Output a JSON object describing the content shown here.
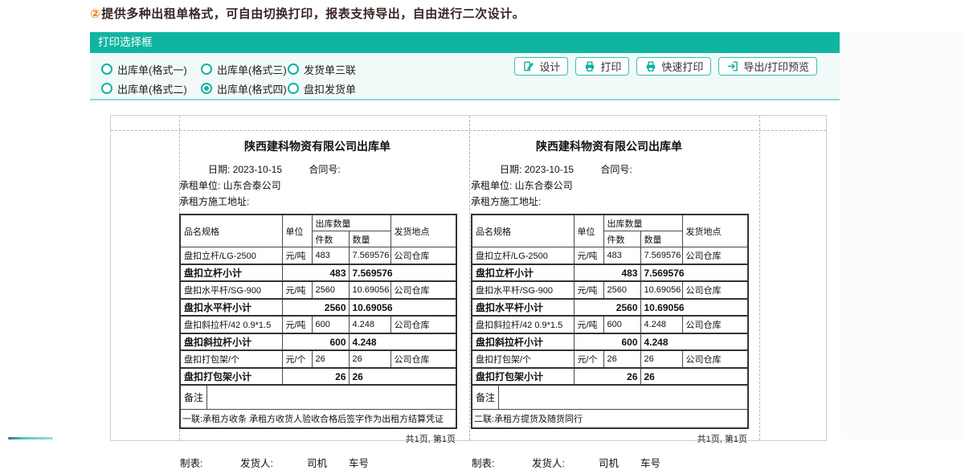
{
  "top_note": {
    "badge": "②",
    "text": "提供多种出租单格式，可自由切换打印，报表支持导出，自由进行二次设计。"
  },
  "panel": {
    "title": "打印选择框",
    "radios": [
      {
        "label": "出库单(格式一)",
        "selected": false
      },
      {
        "label": "出库单(格式二)",
        "selected": false
      },
      {
        "label": "出库单(格式三)",
        "selected": false
      },
      {
        "label": "出库单(格式四)",
        "selected": true
      },
      {
        "label": "发货单三联",
        "selected": false
      },
      {
        "label": "盘扣发货单",
        "selected": false
      }
    ],
    "buttons": [
      {
        "label": "设计",
        "icon": "design-icon"
      },
      {
        "label": "打印",
        "icon": "print-icon"
      },
      {
        "label": "快速打印",
        "icon": "quick-print-icon"
      },
      {
        "label": "导出/打印预览",
        "icon": "export-icon"
      }
    ]
  },
  "document": {
    "title": "陕西建科物资有限公司出库单",
    "date_label": "日期:",
    "date": "2023-10-15",
    "contract_label": "合同号:",
    "lessee_line": "承租单位:  山东合泰公司",
    "site_line": "承租方施工地址:",
    "table": {
      "headers": {
        "product": "品名规格",
        "unit": "单位",
        "qty_group": "出库数量",
        "pieces": "件数",
        "quantity": "数量",
        "location": "发货地点"
      },
      "rows": [
        {
          "type": "item",
          "product": "盘扣立杆/LG-2500",
          "unit": "元/吨",
          "pieces": "483",
          "quantity": "7.569576",
          "location": "公司仓库"
        },
        {
          "type": "subtotal",
          "product": "盘扣立杆小计",
          "pieces": "483",
          "quantity": "7.569576"
        },
        {
          "type": "item",
          "product": "盘扣水平杆/SG-900",
          "unit": "元/吨",
          "pieces": "2560",
          "quantity": "10.69056",
          "location": "公司仓库"
        },
        {
          "type": "subtotal",
          "product": "盘扣水平杆小计",
          "pieces": "2560",
          "quantity": "10.69056"
        },
        {
          "type": "item",
          "product": "盘扣斜拉杆/42  0.9*1.5",
          "unit": "元/吨",
          "pieces": "600",
          "quantity": "4.248",
          "location": "公司仓库"
        },
        {
          "type": "subtotal",
          "product": "盘扣斜拉杆小计",
          "pieces": "600",
          "quantity": "4.248"
        },
        {
          "type": "item",
          "product": "盘扣打包架/个",
          "unit": "元/个",
          "pieces": "26",
          "quantity": "26",
          "location": "公司仓库"
        },
        {
          "type": "subtotal",
          "product": "盘扣打包架小计",
          "pieces": "26",
          "quantity": "26"
        }
      ]
    },
    "remark_label": "备注",
    "copies": [
      {
        "note": "一联:承租方收条 承租方收货人验收合格后签字作为出租方结算凭证"
      },
      {
        "note": "二联:承租方提货及随货同行"
      }
    ],
    "page_info": "共1页, 第1页",
    "footer": {
      "maker": "制表:",
      "shipper": "发货人:",
      "driver": "司机",
      "plate": "车号"
    }
  },
  "colors": {
    "accent_teal": "#10b5a2",
    "panel_bg": "#f2faf9",
    "panel_border_bottom": "#86dbd1",
    "button_border": "#3abdb1",
    "badge_orange": "#ee8411",
    "note_text": "#3a2424",
    "guide_dash": "#b5b5b5",
    "table_border": "#333333"
  }
}
